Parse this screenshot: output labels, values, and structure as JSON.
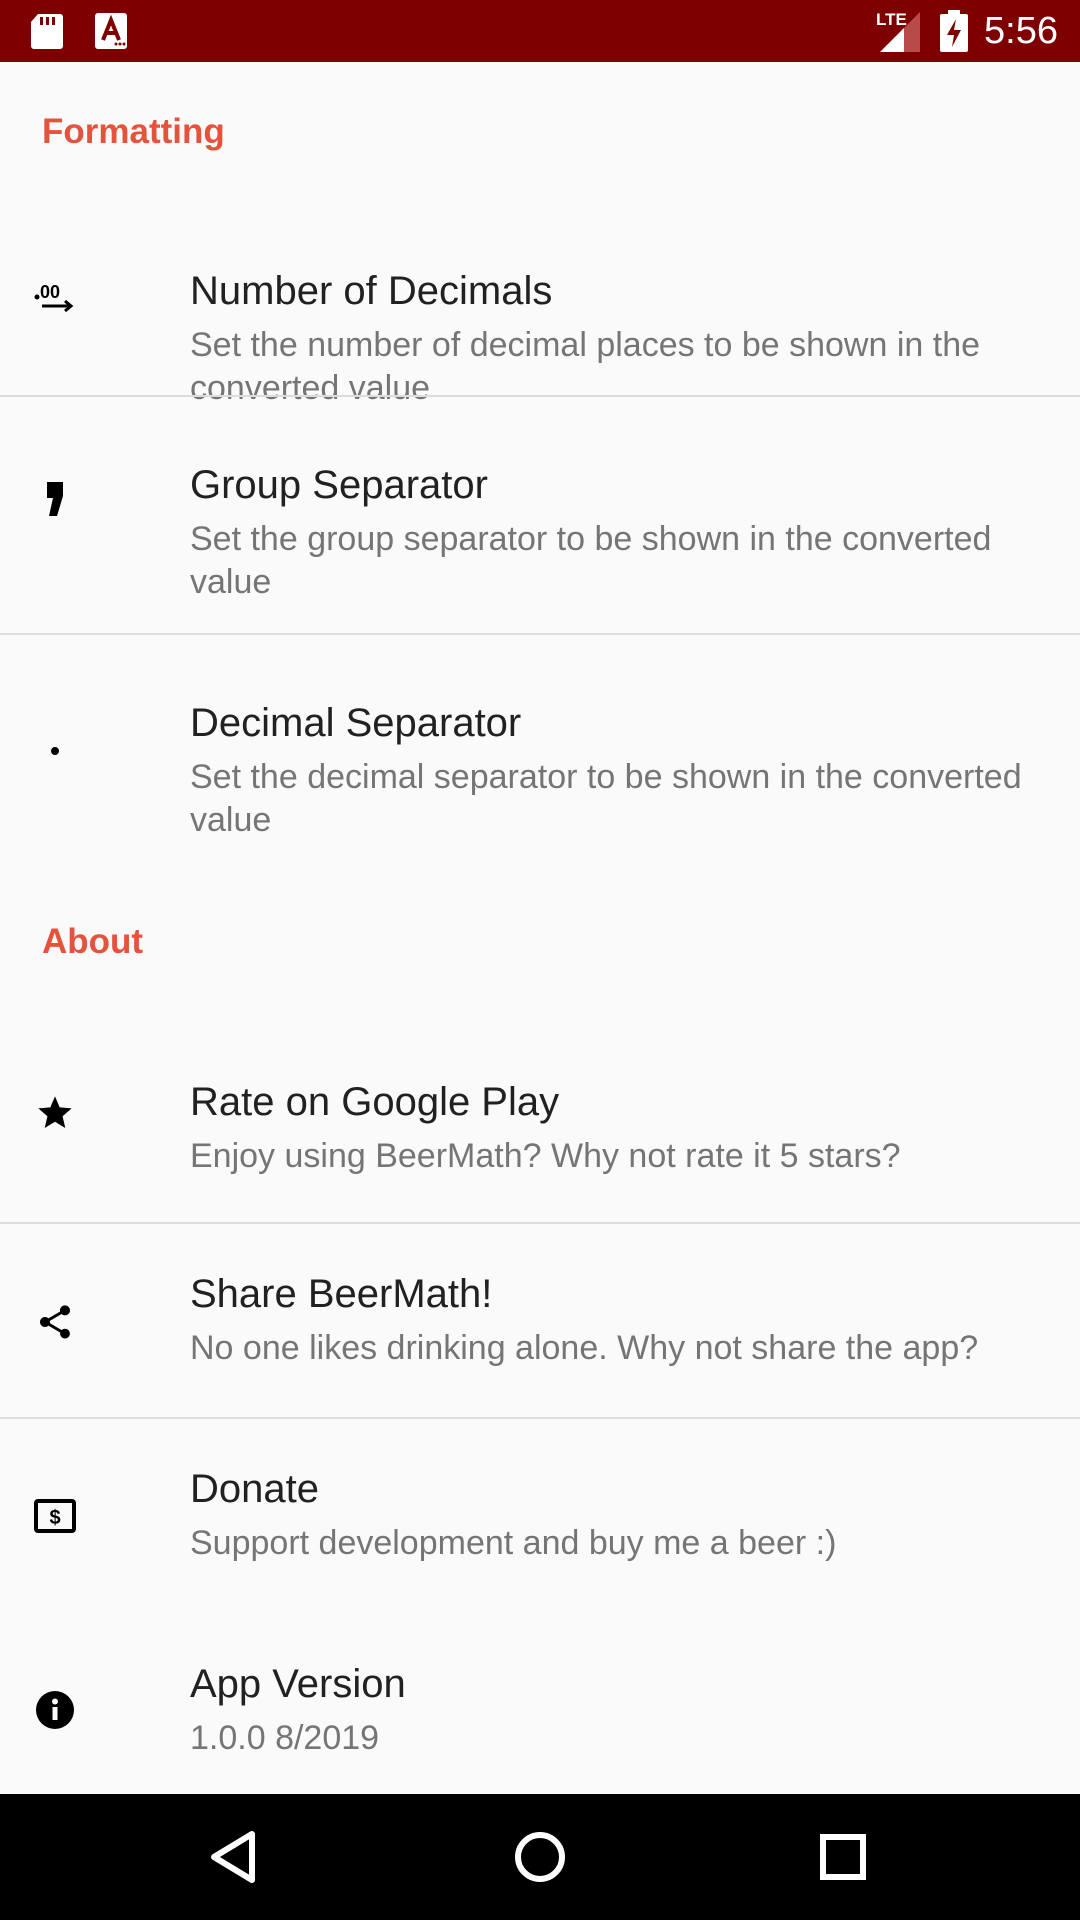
{
  "status_bar": {
    "time": "5:56",
    "network": "LTE",
    "icons": [
      "sd-card-icon",
      "font-a-icon",
      "signal-icon",
      "battery-charging-icon"
    ]
  },
  "sections": {
    "formatting": {
      "header": "Formatting"
    },
    "about": {
      "header": "About"
    }
  },
  "prefs": {
    "decimals": {
      "title": "Number of Decimals",
      "summary": "Set the number of decimal places to be shown in the converted value",
      "icon": "decimal-places-icon"
    },
    "group_sep": {
      "title": "Group Separator",
      "summary": "Set the group separator to be shown in the converted value",
      "icon": "comma-icon"
    },
    "decimal_sep": {
      "title": "Decimal Separator",
      "summary": "Set the decimal separator to be shown in the converted value",
      "icon": "dot-icon"
    },
    "rate": {
      "title": "Rate on Google Play",
      "summary": "Enjoy using BeerMath? Why not rate it 5 stars?",
      "icon": "star-icon"
    },
    "share": {
      "title": "Share BeerMath!",
      "summary": "No one likes drinking alone. Why not share the app?",
      "icon": "share-icon"
    },
    "donate": {
      "title": "Donate",
      "summary": "Support development and buy me a beer :)",
      "icon": "dollar-bill-icon"
    },
    "version": {
      "title": "App Version",
      "summary": "1.0.0 8/2019",
      "icon": "info-icon"
    }
  },
  "colors": {
    "status_bar": "#7f0000",
    "accent": "#e5533d",
    "title_text": "#212121",
    "summary_text": "#757575",
    "nav_bar": "#000000"
  },
  "nav_bar": {
    "buttons": [
      "back-icon",
      "home-icon",
      "recents-icon"
    ]
  }
}
